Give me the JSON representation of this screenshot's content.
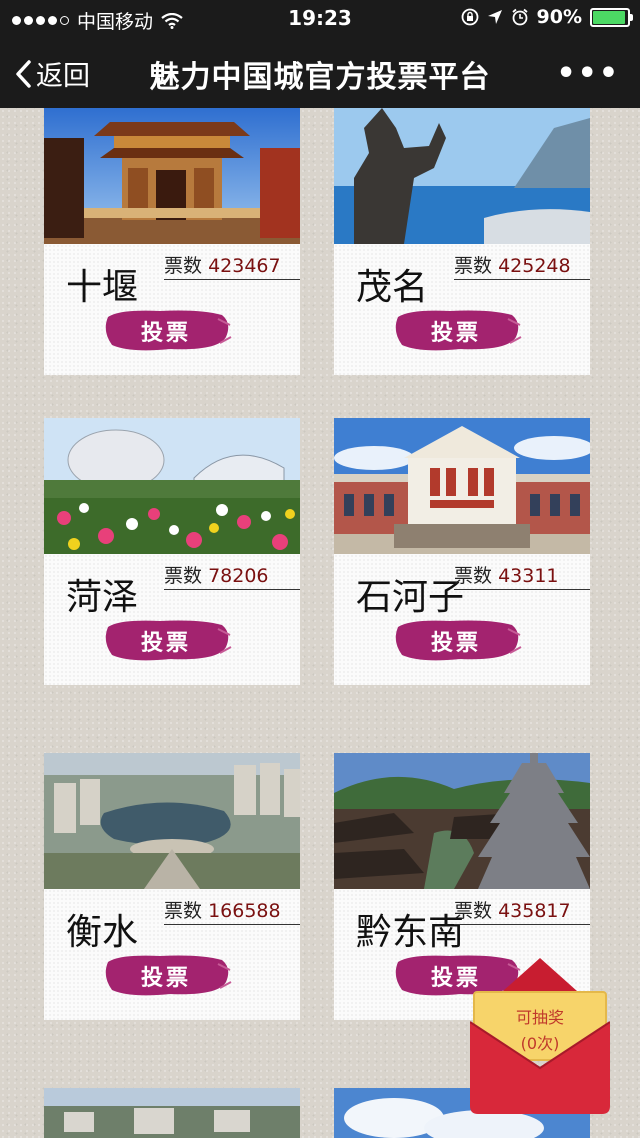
{
  "status_bar": {
    "carrier": "中国移动",
    "time": "19:23",
    "battery": "90%",
    "battery_level": 0.9
  },
  "nav": {
    "back_label": "返回",
    "title": "魅力中国城官方投票平台",
    "more_label": "•••"
  },
  "cards": [
    {
      "city": "十堰",
      "votes_label": "票数",
      "votes": "423467",
      "button": "投票"
    },
    {
      "city": "茂名",
      "votes_label": "票数",
      "votes": "425248",
      "button": "投票"
    },
    {
      "city": "菏泽",
      "votes_label": "票数",
      "votes": "78206",
      "button": "投票"
    },
    {
      "city": "石河子",
      "votes_label": "票数",
      "votes": "43311",
      "button": "投票"
    },
    {
      "city": "衡水",
      "votes_label": "票数",
      "votes": "166588",
      "button": "投票"
    },
    {
      "city": "黔东南",
      "votes_label": "票数",
      "votes": "435817",
      "button": "投票"
    }
  ],
  "red_packet": {
    "line1": "可抽奖",
    "line2": "(0次)"
  },
  "colors": {
    "bar": "#1b1b1b",
    "vote_button": "#a3236f",
    "vote_number": "#7a1010",
    "red_packet": "#d8283a"
  }
}
